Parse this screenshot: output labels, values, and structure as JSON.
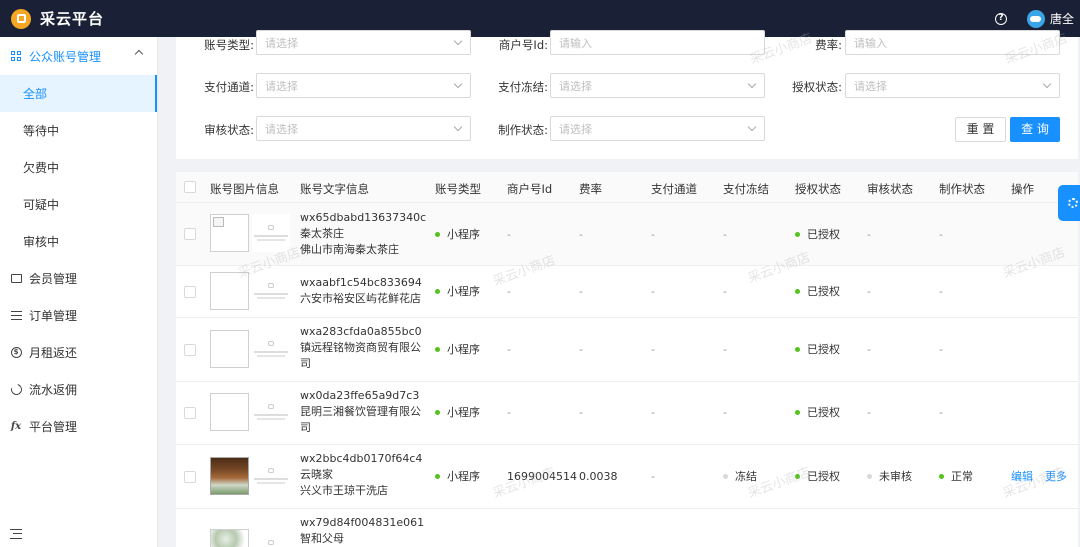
{
  "app": {
    "title": "采云平台",
    "username": "唐全"
  },
  "sidebar": {
    "group": {
      "label": "公众账号管理",
      "icon": "grid-icon"
    },
    "sub_items": [
      "全部",
      "等待中",
      "欠费中",
      "可疑中",
      "审核中"
    ],
    "items": [
      {
        "label": "会员管理",
        "icon": "id-card-icon"
      },
      {
        "label": "订单管理",
        "icon": "list-icon"
      },
      {
        "label": "月租返还",
        "icon": "dollar-coin-icon"
      },
      {
        "label": "流水返佣",
        "icon": "pie-chart-icon"
      },
      {
        "label": "平台管理",
        "icon": "function-fx-icon"
      }
    ]
  },
  "filters": {
    "account_type": {
      "label": "账号类型:",
      "placeholder": "请选择"
    },
    "merchant_id": {
      "label": "商户号Id:",
      "placeholder": "请输入"
    },
    "rate": {
      "label": "费率:",
      "placeholder": "请输入"
    },
    "pay_channel": {
      "label": "支付通道:",
      "placeholder": "请选择"
    },
    "pay_freeze": {
      "label": "支付冻结:",
      "placeholder": "请选择"
    },
    "auth_status": {
      "label": "授权状态:",
      "placeholder": "请选择"
    },
    "review_status": {
      "label": "审核状态:",
      "placeholder": "请选择"
    },
    "make_status": {
      "label": "制作状态:",
      "placeholder": "请选择"
    },
    "reset_label": "重 置",
    "query_label": "查 询"
  },
  "table": {
    "columns": [
      "账号图片信息",
      "账号文字信息",
      "账号类型",
      "商户号Id",
      "费率",
      "支付通道",
      "支付冻结",
      "授权状态",
      "审核状态",
      "制作状态",
      "操作"
    ],
    "rows": [
      {
        "line1": "wx65dbabd13637340c",
        "line2": "秦太茶庄",
        "line3": "佛山市南海秦太茶庄",
        "type": "小程序",
        "merchant": "-",
        "rate": "-",
        "channel": "-",
        "freeze": "-",
        "auth": "已授权",
        "review": "-",
        "make": "-"
      },
      {
        "line1": "wxaabf1c54bc833694",
        "line2": "六安市裕安区屿花鲜花店",
        "line3": "",
        "type": "小程序",
        "merchant": "-",
        "rate": "-",
        "channel": "-",
        "freeze": "-",
        "auth": "已授权",
        "review": "-",
        "make": "-"
      },
      {
        "line1": "wxa283cfda0a855bc0",
        "line2": "镇远程铭物资商贸有限公",
        "line3": "司",
        "type": "小程序",
        "merchant": "-",
        "rate": "-",
        "channel": "-",
        "freeze": "-",
        "auth": "已授权",
        "review": "-",
        "make": "-"
      },
      {
        "line1": "wx0da23ffe65a9d7c3",
        "line2": "昆明三湘餐饮管理有限公",
        "line3": "司",
        "type": "小程序",
        "merchant": "-",
        "rate": "-",
        "channel": "-",
        "freeze": "-",
        "auth": "已授权",
        "review": "-",
        "make": "-"
      },
      {
        "line1": "wx2bbc4db0170f64c4",
        "line2": "云晓家",
        "line3": "兴义市王琼干洗店",
        "type": "小程序",
        "merchant": "1699004514",
        "rate": "0.0038",
        "channel": "-",
        "freeze": "冻结",
        "auth": "已授权",
        "review": "未审核",
        "make": "正常",
        "edit": "编辑",
        "more": "更多"
      },
      {
        "line1": "wx79d84f004831e061",
        "line2": "智和父母",
        "line3": ""
      }
    ]
  },
  "watermark": "采云小商店"
}
